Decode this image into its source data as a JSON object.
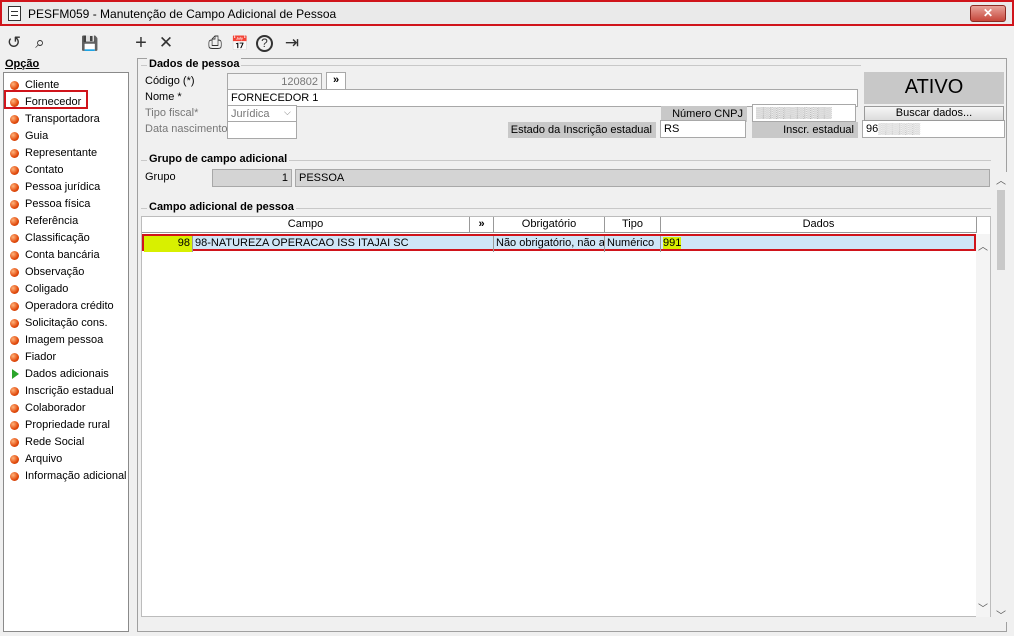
{
  "window": {
    "title": "PESFM059 - Manutenção de Campo Adicional de Pessoa",
    "close": "✕"
  },
  "toolbar": {
    "undo": "↺",
    "search": "⌕",
    "save": "💾",
    "add": "+",
    "remove": "✕",
    "print": "⎙",
    "calendar": "📅",
    "help": "?",
    "exit": "⇥"
  },
  "sidebar": {
    "label": "Opção",
    "items": [
      {
        "label": "Cliente"
      },
      {
        "label": "Fornecedor"
      },
      {
        "label": "Transportadora"
      },
      {
        "label": "Guia"
      },
      {
        "label": "Representante"
      },
      {
        "label": "Contato"
      },
      {
        "label": "Pessoa jurídica"
      },
      {
        "label": "Pessoa física"
      },
      {
        "label": "Referência"
      },
      {
        "label": "Classificação"
      },
      {
        "label": "Conta bancária"
      },
      {
        "label": "Observação"
      },
      {
        "label": "Coligado"
      },
      {
        "label": "Operadora crédito"
      },
      {
        "label": "Solicitação cons."
      },
      {
        "label": "Imagem pessoa"
      },
      {
        "label": "Fiador"
      },
      {
        "label": "Dados adicionais"
      },
      {
        "label": "Inscrição estadual"
      },
      {
        "label": "Colaborador"
      },
      {
        "label": "Propriedade rural"
      },
      {
        "label": "Rede Social"
      },
      {
        "label": "Arquivo"
      },
      {
        "label": "Informação adicional"
      }
    ]
  },
  "dados_pessoa": {
    "title": "Dados de pessoa",
    "codigo_label": "Código (*)",
    "codigo_value": "120802",
    "codigo_btn": "»",
    "nome_label": "Nome *",
    "nome_value": "FORNECEDOR 1",
    "tipo_fiscal_label": "Tipo fiscal*",
    "tipo_fiscal_value": "Jurídica",
    "data_nasc_label": "Data nascimento",
    "data_nasc_value": "",
    "cnpj_label": "Número CNPJ",
    "cnpj_value": "▒▒▒▒▒▒▒▒▒▒▒",
    "estado_ie_label": "Estado da Inscrição estadual",
    "estado_ie_value": "RS",
    "ie_label": "Inscr. estadual",
    "ie_value": "96",
    "ie_blur": "▒▒▒▒▒▒",
    "status": "ATIVO",
    "buscar_btn": "Buscar dados..."
  },
  "grupo": {
    "title": "Grupo de campo adicional",
    "grupo_label": "Grupo",
    "grupo_code": "1",
    "grupo_name": "PESSOA"
  },
  "campo": {
    "title": "Campo adicional de pessoa",
    "headers": {
      "campo": "Campo",
      "expand": "»",
      "obrigatorio": "Obrigatório",
      "tipo": "Tipo",
      "dados": "Dados"
    },
    "rows": [
      {
        "code": "98",
        "name": "98-NATUREZA OPERACAO ISS ITAJAI SC",
        "obrigatorio": "Não obrigatório, não a",
        "tipo": "Numérico",
        "dados": "991"
      }
    ]
  }
}
